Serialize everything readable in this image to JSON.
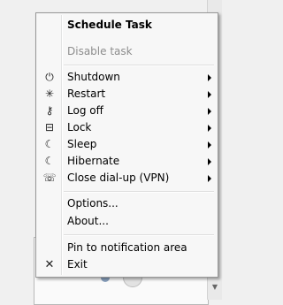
{
  "menu": {
    "title": "Schedule Task",
    "disable_task": "Disable task",
    "actions": [
      {
        "id": "shutdown",
        "label": "Shutdown",
        "icon": "power-icon",
        "glyph": "⏻"
      },
      {
        "id": "restart",
        "label": "Restart",
        "icon": "restart-icon",
        "glyph": "✳"
      },
      {
        "id": "logoff",
        "label": "Log off",
        "icon": "key-icon",
        "glyph": "⚷"
      },
      {
        "id": "lock",
        "label": "Lock",
        "icon": "lock-icon",
        "glyph": "⊟"
      },
      {
        "id": "sleep",
        "label": "Sleep",
        "icon": "moon-icon",
        "glyph": "☾"
      },
      {
        "id": "hibernate",
        "label": "Hibernate",
        "icon": "moon-icon",
        "glyph": "☾"
      },
      {
        "id": "dialup",
        "label": "Close dial-up (VPN)",
        "icon": "telephone-icon",
        "glyph": "☏"
      }
    ],
    "options": "Options...",
    "about": "About...",
    "pin": "Pin to notification area",
    "exit": "Exit",
    "exit_glyph": "✕"
  }
}
